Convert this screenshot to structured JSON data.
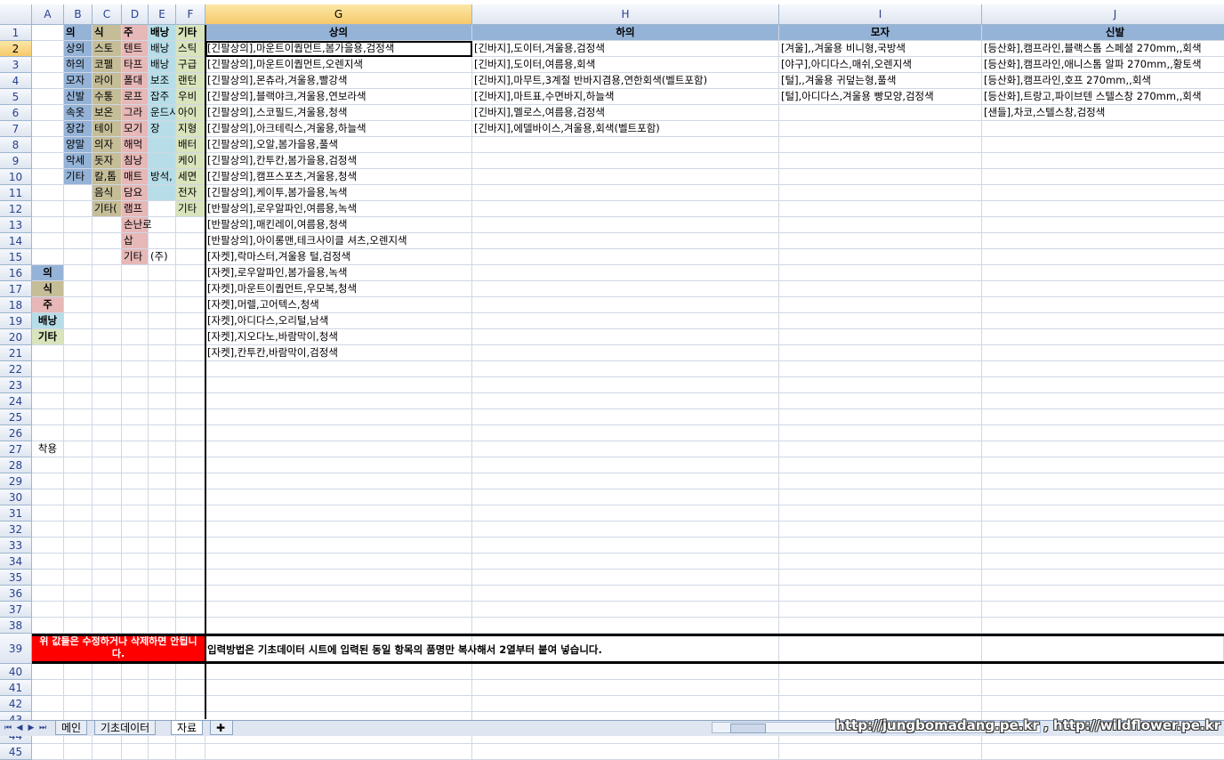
{
  "app": "spreadsheet",
  "columns": [
    "A",
    "B",
    "C",
    "D",
    "E",
    "F",
    "G",
    "H",
    "I",
    "J"
  ],
  "selected_column": "G",
  "selected_row": 2,
  "row_numbers": [
    1,
    2,
    3,
    4,
    5,
    6,
    7,
    8,
    9,
    10,
    11,
    12,
    13,
    14,
    15,
    16,
    17,
    18,
    19,
    20,
    21,
    22,
    23,
    24,
    25,
    26,
    27,
    28,
    29,
    30,
    31,
    32,
    33,
    34,
    35,
    36,
    37,
    38,
    39,
    40,
    41,
    42,
    43,
    44,
    45
  ],
  "header_row": {
    "B": "의",
    "C": "식",
    "D": "주",
    "E": "배낭",
    "F": "기타",
    "G": "상의",
    "H": "하의",
    "I": "모자",
    "J": "신발"
  },
  "colB": [
    "상의",
    "하의",
    "모자",
    "신발",
    "속옷",
    "장갑",
    "양말",
    "악세",
    "기타"
  ],
  "colC": [
    "스토",
    "코펠",
    "라이",
    "수통",
    "보온",
    "테이",
    "의자",
    "돗자",
    "칼,톱",
    "음식",
    "기타("
  ],
  "colD": [
    "텐트",
    "타프",
    "폴대",
    "로프",
    "그라",
    "모기",
    "해먹",
    "침낭",
    "매트",
    "담요",
    "램프",
    "손난로",
    "삽",
    "기타"
  ],
  "colE": [
    "배낭",
    "배낭",
    "보조",
    "잡주",
    "운드시",
    "장",
    "",
    "",
    "방석,",
    ""
  ],
  "colF": [
    "스틱",
    "구급",
    "랜턴",
    "우비",
    "아이",
    "지형",
    "배터",
    "케이",
    "세면",
    "전자",
    "기타"
  ],
  "colE_extra": {
    "15": "(주)"
  },
  "colG": [
    "[긴팔상의],마운트이퀍먼트,봄가을용,검정색",
    "[긴팔상의],마운트이퀍먼트,오렌지색",
    "[긴팔상의],몬츄라,겨울용,빨강색",
    "[긴팔상의],블랙야크,겨울용,연보라색",
    "[긴팔상의],스코필드,겨울용,청색",
    "[긴팔상의],아크테릭스,겨울용,하늘색",
    "[긴팔상의],오알,봄가을용,풀색",
    "[긴팔상의],칸투칸,봄가을용,검정색",
    "[긴팔상의],캠프스포츠,겨울용,청색",
    "[긴팔상의],케이투,봄가을용,녹색",
    "[반팔상의],로우알파인,여름용,녹색",
    "[반팔상의],매킨레이,여름용,청색",
    "[반팔상의],아이롱맨,테크사이클 셔츠,오렌지색",
    "[자켓],락마스터,겨울용 털,검정색",
    "[자켓],로우알파인,봄가을용,녹색",
    "[자켓],마운트이퀍먼트,우모복,청색",
    "[자켓],머렐,고어텍스,청색",
    "[자켓],아디다스,오리털,남색",
    "[자켓],지오다노,바람막이,청색",
    "[자켓],칸투칸,바람막이,검정색"
  ],
  "colH": [
    "[긴바지],도이터,겨울용,검정색",
    "[긴바지],도이터,여름용,회색",
    "[긴바지],마무트,3계절 반바지겸용,연한회색(벨트포함)",
    "[긴바지],마트표,수면바지,하늘색",
    "[긴바지],멜로스,여름용,검정색",
    "[긴바지],에델바이스,겨울용,회색(벨트포함)"
  ],
  "colI": [
    "[겨울],,겨울용 비니형,국방색",
    "[야구],아디다스,매쉬,오렌지색",
    "[털],,겨울용 귀덮는형,풀색",
    "[털],아디다스,겨울용 빵모양,검정색"
  ],
  "colJ": [
    "[등산화],캠프라인,블랙스톰 스페셜 270mm,,회색",
    "[등산화],캠프라인,애니스톰 알파 270mm,,황토색",
    "[등산화],캠프라인,호프 270mm,,회색",
    "[등산화],트랑고,파이브텐 스텔스창 270mm,,회색",
    "[샌들],차코,스텔스창,검정색"
  ],
  "legend": [
    "의",
    "식",
    "주",
    "배낭",
    "기타"
  ],
  "a27": "착용",
  "warning": "위 값들은 수정하거나 삭제하면 안됩니다.",
  "instruction": "입력방법은 기초데이터 시트에 입력된 동일 항목의 품명만 복사해서 2열부터 붙여 넣습니다.",
  "tabs": [
    "메인",
    "기초데이터",
    "자료"
  ],
  "active_tab": "자료",
  "watermark": "http://jungbomadang.pe.kr , http://wildflower.pe.kr",
  "colors": {
    "blue": "#95b3d7",
    "tan": "#c4bd97",
    "pink": "#e6b8b7",
    "lightblue": "#b7dee8",
    "lightgreen": "#d8e4bc",
    "warning": "#ff0000"
  }
}
